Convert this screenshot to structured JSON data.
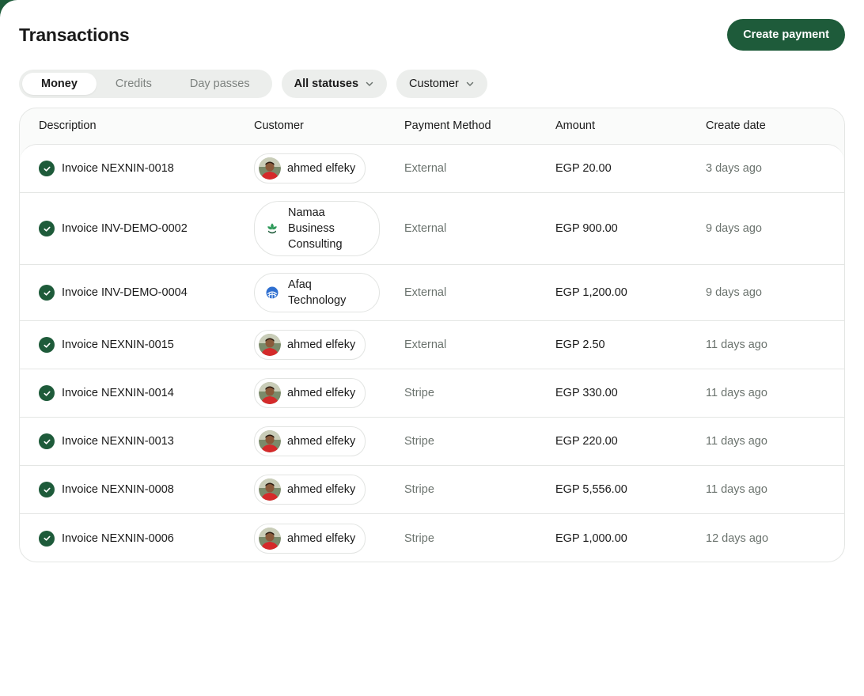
{
  "header": {
    "title": "Transactions",
    "create_label": "Create payment"
  },
  "colors": {
    "accent": "#1e5b3a"
  },
  "filters": {
    "tabs": [
      {
        "label": "Money",
        "active": true
      },
      {
        "label": "Credits",
        "active": false
      },
      {
        "label": "Day passes",
        "active": false
      }
    ],
    "status_label": "All statuses",
    "customer_label": "Customer"
  },
  "table": {
    "columns": [
      "Description",
      "Customer",
      "Payment Method",
      "Amount",
      "Create date"
    ],
    "rows": [
      {
        "description": "Invoice NEXNIN-0018",
        "customer": "ahmed elfeky",
        "customer_icon": "person-avatar",
        "method": "External",
        "amount": "EGP 20.00",
        "date": "3 days ago"
      },
      {
        "description": "Invoice INV-DEMO-0002",
        "customer": "Namaa Business Consulting",
        "customer_icon": "leaf-logo-icon",
        "method": "External",
        "amount": "EGP 900.00",
        "date": "9 days ago"
      },
      {
        "description": "Invoice INV-DEMO-0004",
        "customer": "Afaq Technology",
        "customer_icon": "globe-logo-icon",
        "method": "External",
        "amount": "EGP 1,200.00",
        "date": "9 days ago"
      },
      {
        "description": "Invoice NEXNIN-0015",
        "customer": "ahmed elfeky",
        "customer_icon": "person-avatar",
        "method": "External",
        "amount": "EGP 2.50",
        "date": "11 days ago"
      },
      {
        "description": "Invoice NEXNIN-0014",
        "customer": "ahmed elfeky",
        "customer_icon": "person-avatar",
        "method": "Stripe",
        "amount": "EGP 330.00",
        "date": "11 days ago"
      },
      {
        "description": "Invoice NEXNIN-0013",
        "customer": "ahmed elfeky",
        "customer_icon": "person-avatar",
        "method": "Stripe",
        "amount": "EGP 220.00",
        "date": "11 days ago"
      },
      {
        "description": "Invoice NEXNIN-0008",
        "customer": "ahmed elfeky",
        "customer_icon": "person-avatar",
        "method": "Stripe",
        "amount": "EGP 5,556.00",
        "date": "11 days ago"
      },
      {
        "description": "Invoice NEXNIN-0006",
        "customer": "ahmed elfeky",
        "customer_icon": "person-avatar",
        "method": "Stripe",
        "amount": "EGP 1,000.00",
        "date": "12 days ago"
      }
    ]
  }
}
